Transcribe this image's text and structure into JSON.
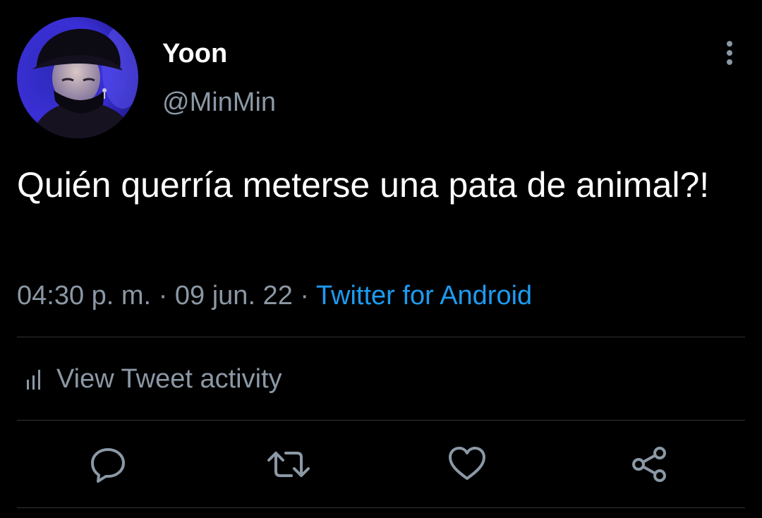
{
  "colors": {
    "background": "#000000",
    "primary_text": "#ffffff",
    "secondary_text": "#8b98a5",
    "link": "#1d9bf0",
    "divider": "#2f3336",
    "avatar_accent": "#3a2fd6"
  },
  "author": {
    "display_name": "Yoon",
    "handle": "@MinMin",
    "avatar_icon": "profile-photo"
  },
  "tweet": {
    "text": "Quién querría meterse una pata de animal?!",
    "time": "04:30 p. m.",
    "separator": "·",
    "date": "09 jun. 22",
    "source": "Twitter for Android"
  },
  "activity": {
    "icon": "bar-chart-icon",
    "label": "View Tweet activity"
  },
  "actions": {
    "icons": [
      "reply-icon",
      "retweet-icon",
      "like-icon",
      "share-icon"
    ]
  },
  "header": {
    "more_icon": "vertical-ellipsis-icon"
  }
}
